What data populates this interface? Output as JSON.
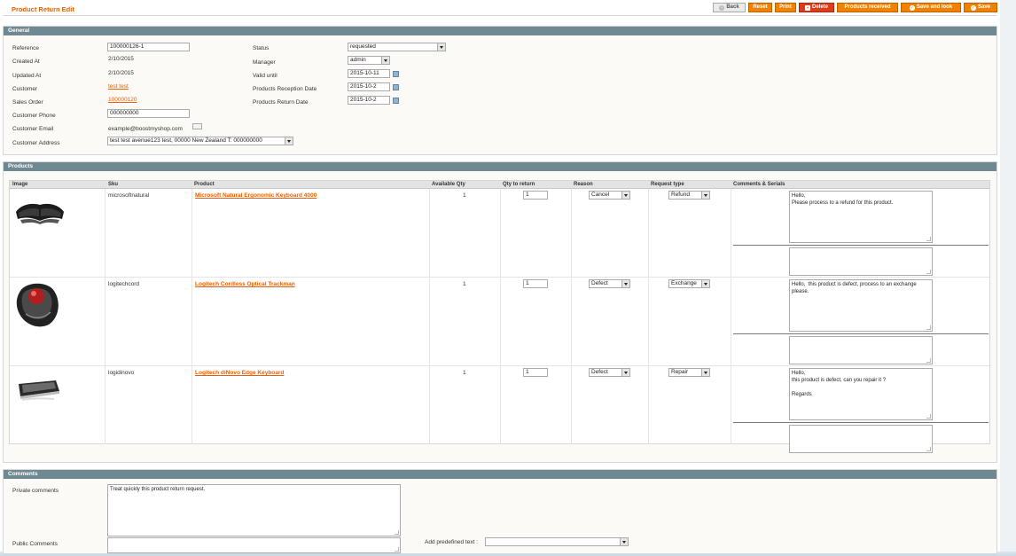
{
  "page": {
    "title": "Product Return Edit"
  },
  "toolbar": {
    "back": "Back",
    "reset": "Reset",
    "print": "Print",
    "delete": "Delete",
    "products_received": "Products received",
    "save_and_look": "Save and look",
    "save": "Save"
  },
  "general": {
    "header": "General",
    "reference_label": "Reference",
    "reference_value": "100000126-1",
    "created_label": "Created At",
    "created_value": "2/10/2015",
    "updated_label": "Updated At",
    "updated_value": "2/10/2015",
    "customer_label": "Customer",
    "customer_value": "test test",
    "sales_order_label": "Sales Order",
    "sales_order_value": "100000120",
    "phone_label": "Customer Phone",
    "phone_value": "000000000",
    "email_label": "Customer Email",
    "email_value": "example@boostmyshop.com",
    "address_label": "Customer Address",
    "address_value": "test test avenue123 test, 00000 New Zealand T: 000000000",
    "status_label": "Status",
    "status_value": "requested",
    "manager_label": "Manager",
    "manager_value": "admin",
    "valid_until_label": "Valid until",
    "valid_until_value": "2015-10-11",
    "reception_label": "Products Reception Date",
    "reception_value": "2015-10-2",
    "return_label": "Products Return Date",
    "return_value": "2015-10-2"
  },
  "products": {
    "header": "Products",
    "columns": [
      "Image",
      "Sku",
      "Product",
      "Available Qty",
      "Qty to return",
      "Reason",
      "Request type",
      "Comments & Serials"
    ],
    "rows": [
      {
        "sku": "microsoftnatural",
        "product": "Microsoft Natural Ergonomic Keyboard 4000",
        "available_qty": "1",
        "qty_to_return": "1",
        "reason": "Cancel",
        "request_type": "Refund",
        "comment": "Hello,\nPlease process to a refund for this product.",
        "serials": "",
        "image": "keyboard-ergonomic-icon"
      },
      {
        "sku": "logitechcord",
        "product": "Logitech Cordless Optical Trackman",
        "available_qty": "1",
        "qty_to_return": "1",
        "reason": "Defect",
        "request_type": "Exchange",
        "comment": "Hello,  this product is defect, process to an exchange please.",
        "serials": "",
        "image": "trackball-mouse-icon"
      },
      {
        "sku": "logidinovo",
        "product": "Logitech diNovo Edge Keyboard",
        "available_qty": "1",
        "qty_to_return": "1",
        "reason": "Defect",
        "request_type": "Repair",
        "comment": "Hello,\nthis product is defect, can you repair it ?\n\nRegards",
        "serials": "",
        "image": "keyboard-flat-icon"
      }
    ]
  },
  "comments": {
    "header": "Comments",
    "private_label": "Private comments",
    "private_value": "Treat quickly this product return request.",
    "public_label": "Public Comments",
    "public_value": "",
    "predefined_label": "Add predefined text :",
    "predefined_value": ""
  },
  "colors": {
    "accent": "#f18200",
    "section_header": "#6f8992",
    "link": "#eb5e00"
  }
}
